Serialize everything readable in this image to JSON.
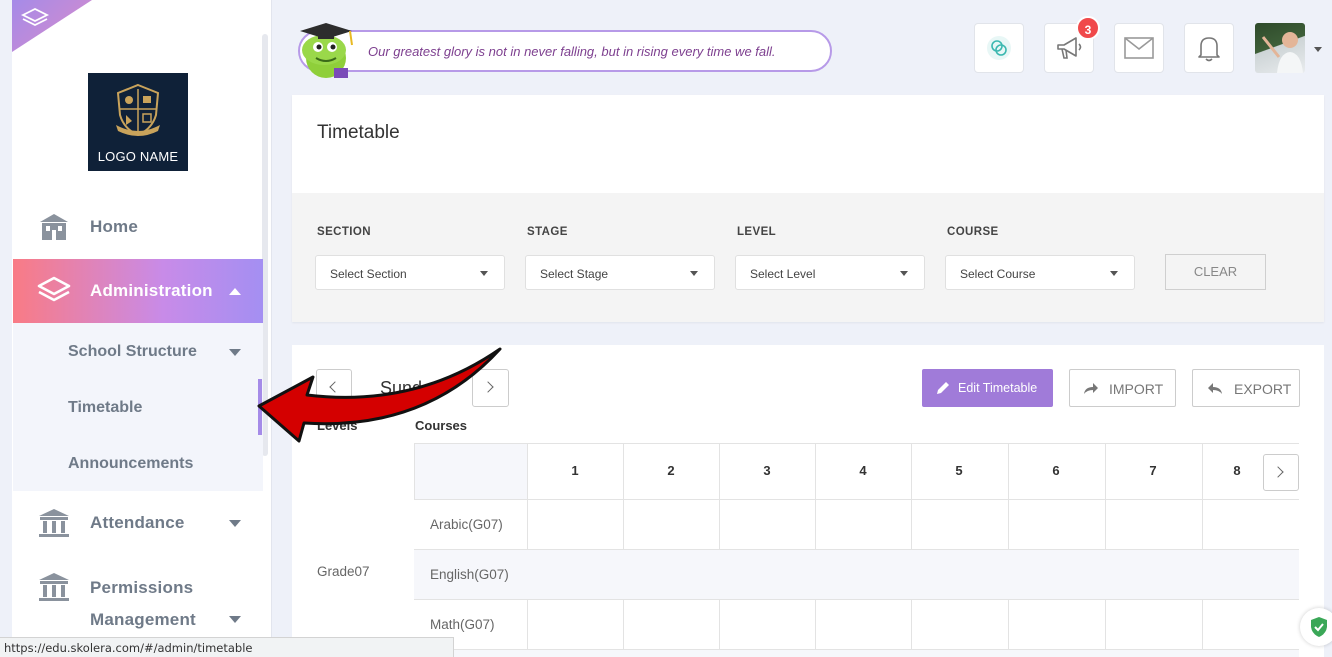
{
  "sidebar": {
    "logo_text": "LOGO NAME",
    "items": [
      {
        "label": "Home",
        "icon": "building-icon"
      },
      {
        "label": "Administration",
        "icon": "layers-icon"
      },
      {
        "label": "Attendance",
        "icon": "bank-icon"
      },
      {
        "label": "Permissions",
        "label2": "Management",
        "icon": "bank-icon"
      }
    ],
    "submenu": [
      {
        "label": "School Structure"
      },
      {
        "label": "Timetable"
      },
      {
        "label": "Announcements"
      }
    ]
  },
  "header": {
    "quote": "Our greatest glory is not in never falling, but in rising every time we fall.",
    "announcement_badge": "3"
  },
  "page": {
    "title": "Timetable",
    "filters": [
      {
        "label": "SECTION",
        "placeholder": "Select Section"
      },
      {
        "label": "STAGE",
        "placeholder": "Select Stage"
      },
      {
        "label": "LEVEL",
        "placeholder": "Select Level"
      },
      {
        "label": "COURSE",
        "placeholder": "Select Course"
      }
    ],
    "clear_label": "CLEAR"
  },
  "timetable": {
    "day": "Sunday",
    "edit_label": "Edit Timetable",
    "import_label": "IMPORT",
    "export_label": "EXPORT",
    "levels_header": "Levels",
    "courses_header": "Courses",
    "periods": [
      "1",
      "2",
      "3",
      "4",
      "5",
      "6",
      "7",
      "8"
    ],
    "grade": "Grade07",
    "courses": [
      "Arabic(G07)",
      "English(G07)",
      "Math(G07)"
    ]
  },
  "statusbar": {
    "url": "https://edu.skolera.com/#/admin/timetable"
  },
  "colors": {
    "accent_purple": "#a07bd9",
    "active_gradient_start": "#f97b85",
    "active_gradient_end": "#a48ff2",
    "badge_red": "#f0494b",
    "arrow_red": "#d40000"
  }
}
